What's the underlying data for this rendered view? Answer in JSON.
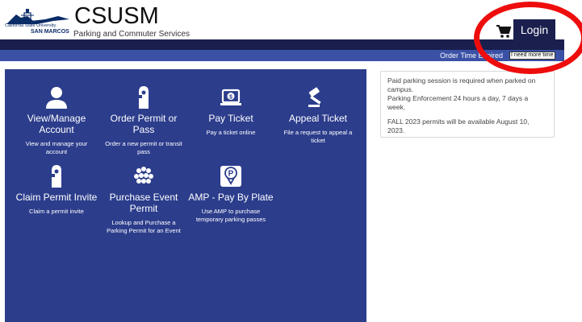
{
  "header": {
    "logo_text_top": "California State University",
    "logo_text_bottom": "SAN MARCOS",
    "title": "CSUSM",
    "subtitle": "Parking and Commuter Services",
    "login_label": "Login",
    "cart_icon": "shopping-cart-icon"
  },
  "session": {
    "order_time_label": "Order Time Expired",
    "more_time_label": "I need more time"
  },
  "tiles": [
    {
      "title": "View/Manage Account",
      "desc": "View and manage your account",
      "icon": "user-icon"
    },
    {
      "title": "Order Permit or Pass",
      "desc": "Order a new permit or transit pass",
      "icon": "hang-tag-icon"
    },
    {
      "title": "Pay Ticket",
      "desc": "Pay a ticket online",
      "icon": "laptop-dollar-icon"
    },
    {
      "title": "Appeal Ticket",
      "desc": "File a request to appeal a ticket",
      "icon": "gavel-icon"
    },
    {
      "title": "Claim Permit Invite",
      "desc": "Claim a permit invite",
      "icon": "hang-tag-icon"
    },
    {
      "title": "Purchase Event Permit",
      "desc": "Lookup and Purchase a Parking Permit for an Event",
      "icon": "crowd-icon"
    },
    {
      "title": "AMP - Pay By Plate",
      "desc": "Use AMP to purchase temporary parking passes",
      "icon": "parking-pin-icon"
    }
  ],
  "info": {
    "line1": "Paid parking session is required when parked on campus.",
    "line2": "Parking Enforcement 24 hours a day, 7 days a week.",
    "line3": "FALL 2023 permits will be available August 10, 2023."
  },
  "colors": {
    "panel": "#2c3d8c",
    "navbar_dark": "#1a1f4e",
    "navbar_blue": "#3a51a6",
    "annotation": "#ee0d0d"
  }
}
